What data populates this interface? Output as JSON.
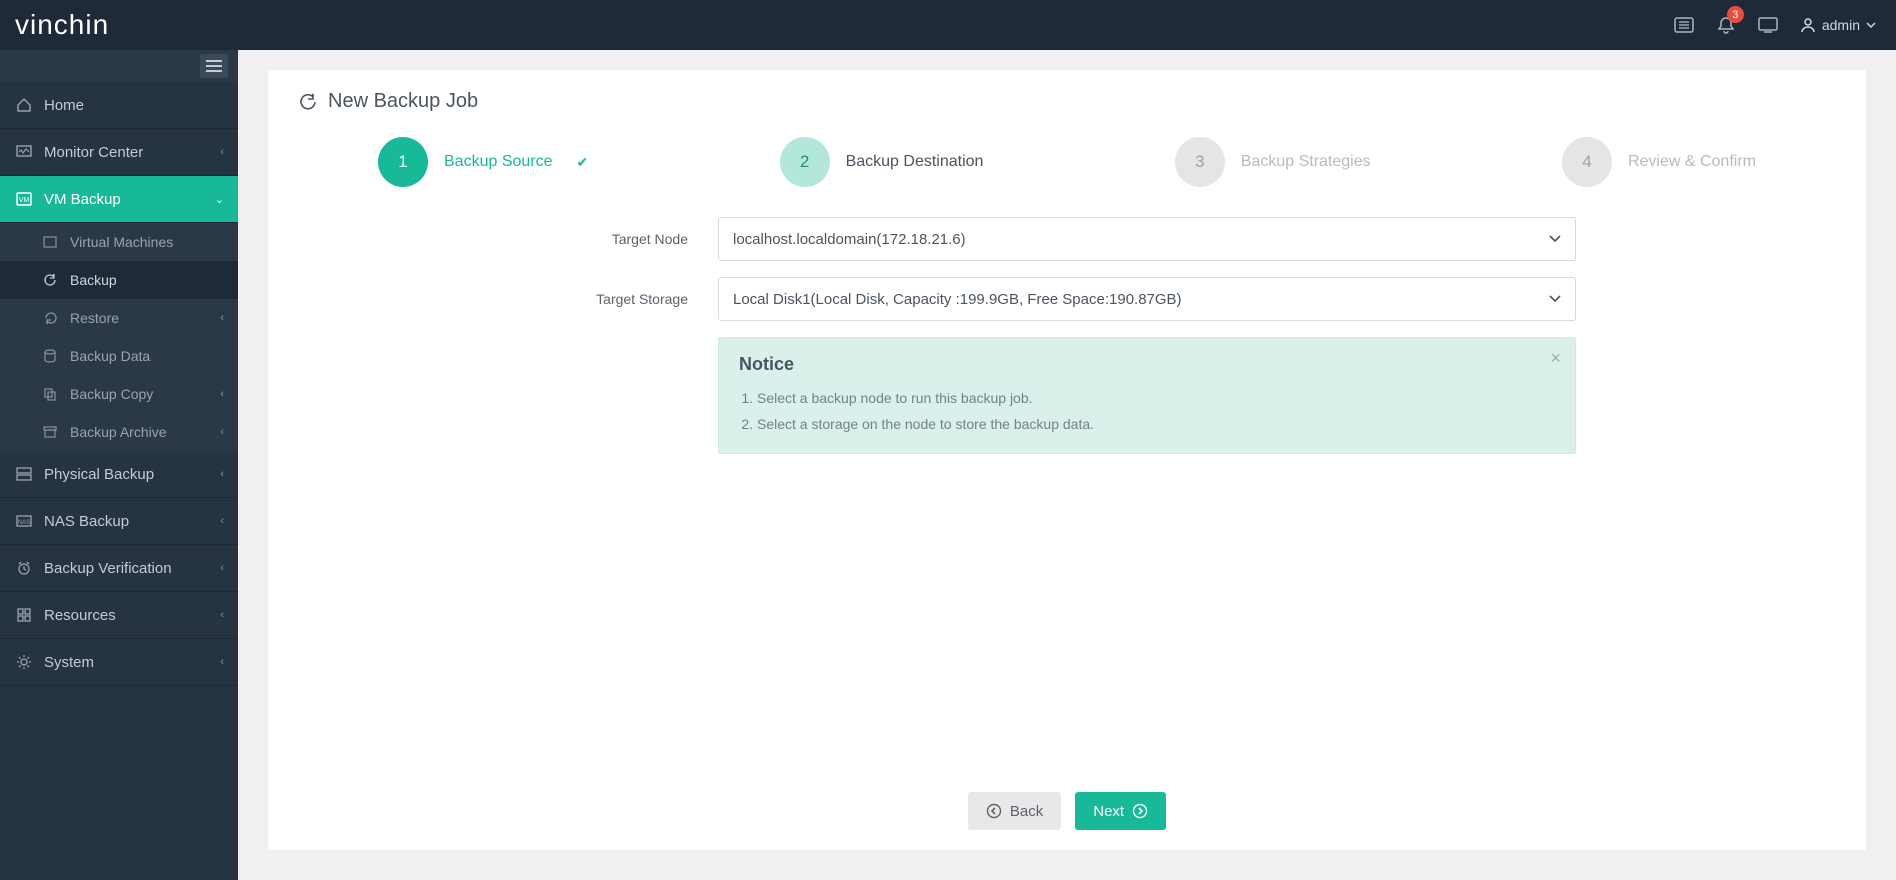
{
  "header": {
    "logo_text": "vinchin",
    "notification_count": "3",
    "user_label": "admin"
  },
  "sidebar": {
    "items": [
      {
        "label": "Home",
        "icon": "home-icon"
      },
      {
        "label": "Monitor Center",
        "icon": "monitor-icon",
        "caret": true
      },
      {
        "label": "VM Backup",
        "icon": "vm-icon",
        "active": true,
        "caret_down": true
      },
      {
        "label": "Physical Backup",
        "icon": "server-icon",
        "caret": true
      },
      {
        "label": "NAS Backup",
        "icon": "nas-icon",
        "caret": true
      },
      {
        "label": "Backup Verification",
        "icon": "clock-icon",
        "caret": true
      },
      {
        "label": "Resources",
        "icon": "grid-icon",
        "caret": true
      },
      {
        "label": "System",
        "icon": "gear-icon",
        "caret": true
      }
    ],
    "vm_backup_sub": [
      {
        "label": "Virtual Machines",
        "icon": "vm-sub-icon"
      },
      {
        "label": "Backup",
        "icon": "refresh-icon",
        "active": true
      },
      {
        "label": "Restore",
        "icon": "undo-icon",
        "caret": true
      },
      {
        "label": "Backup Data",
        "icon": "disk-icon"
      },
      {
        "label": "Backup Copy",
        "icon": "copy-icon",
        "caret": true
      },
      {
        "label": "Backup Archive",
        "icon": "archive-icon",
        "caret": true
      }
    ]
  },
  "page": {
    "title": "New Backup Job",
    "wizard": [
      {
        "num": "1",
        "label": "Backup Source",
        "state": "done",
        "check": true
      },
      {
        "num": "2",
        "label": "Backup Destination",
        "state": "current"
      },
      {
        "num": "3",
        "label": "Backup Strategies",
        "state": "pending"
      },
      {
        "num": "4",
        "label": "Review & Confirm",
        "state": "pending"
      }
    ],
    "form": {
      "target_node_label": "Target Node",
      "target_node_value": "localhost.localdomain(172.18.21.6)",
      "target_storage_label": "Target Storage",
      "target_storage_value": "Local Disk1(Local Disk, Capacity :199.9GB, Free Space:190.87GB)"
    },
    "notice": {
      "title": "Notice",
      "line1": "Select a backup node to run this backup job.",
      "line2": "Select a storage on the node to store the backup data."
    },
    "footer": {
      "back_label": "Back",
      "next_label": "Next"
    }
  }
}
